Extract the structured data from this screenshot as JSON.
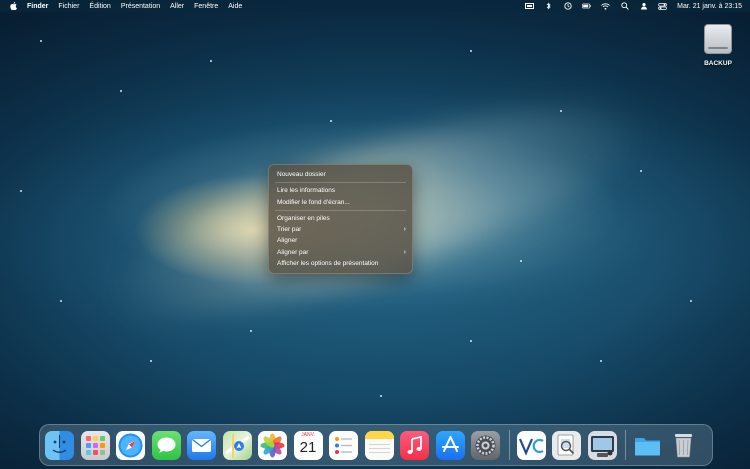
{
  "menubar": {
    "app": "Finder",
    "items": [
      "Fichier",
      "Édition",
      "Présentation",
      "Aller",
      "Fenêtre",
      "Aide"
    ],
    "clock": "Mar. 21 janv. à 23:15",
    "status_icons": [
      "screen-mirroring-icon",
      "bluetooth-icon",
      "time-machine-icon",
      "battery-icon",
      "wifi-icon",
      "search-icon",
      "user-switch-icon",
      "control-center-icon"
    ]
  },
  "desktop": {
    "drive_label": "BACKUP"
  },
  "context_menu": {
    "group1": [
      "Nouveau dossier"
    ],
    "group2": [
      "Lire les informations",
      "Modifier le fond d'écran..."
    ],
    "group3": [
      {
        "label": "Organiser en piles",
        "submenu": false
      },
      {
        "label": "Trier par",
        "submenu": true
      },
      {
        "label": "Aligner",
        "submenu": false
      },
      {
        "label": "Aligner par",
        "submenu": true
      },
      {
        "label": "Afficher les options de présentation",
        "submenu": false
      }
    ],
    "chevron": "›"
  },
  "dock": {
    "calendar_month": "JANV.",
    "calendar_day": "21",
    "apps": [
      "Finder",
      "Launchpad",
      "Safari",
      "Messages",
      "Mail",
      "Plans",
      "Photos",
      "Calendrier",
      "Rappels",
      "Notes",
      "Musique",
      "App Store",
      "Réglages Système",
      "VeraCrypt",
      "Aperçu",
      "Capture d'écran",
      "Téléchargements",
      "Corbeille"
    ]
  }
}
